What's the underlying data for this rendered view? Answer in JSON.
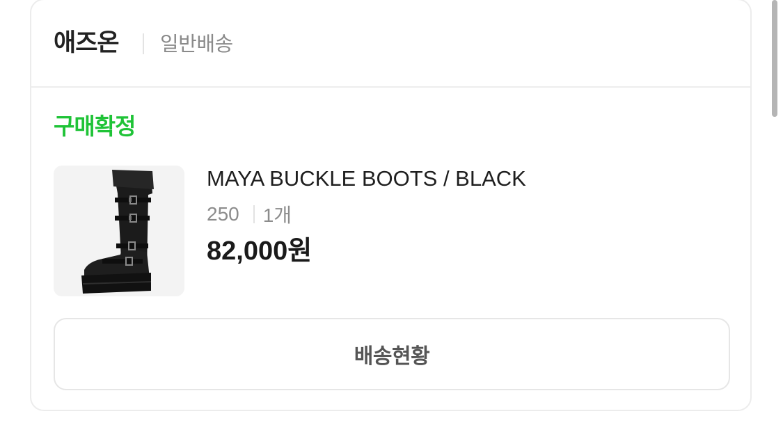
{
  "order_card": {
    "seller_name": "애즈온",
    "shipping_type": "일반배송",
    "status": "구매확정",
    "status_color": "#1fc337",
    "product": {
      "name": "MAYA BUCKLE BOOTS / BLACK",
      "size": "250",
      "quantity": "1개",
      "price": "82,000원",
      "image_icon": "black-knee-high-buckle-boot"
    },
    "action_button_label": "배송현황"
  }
}
